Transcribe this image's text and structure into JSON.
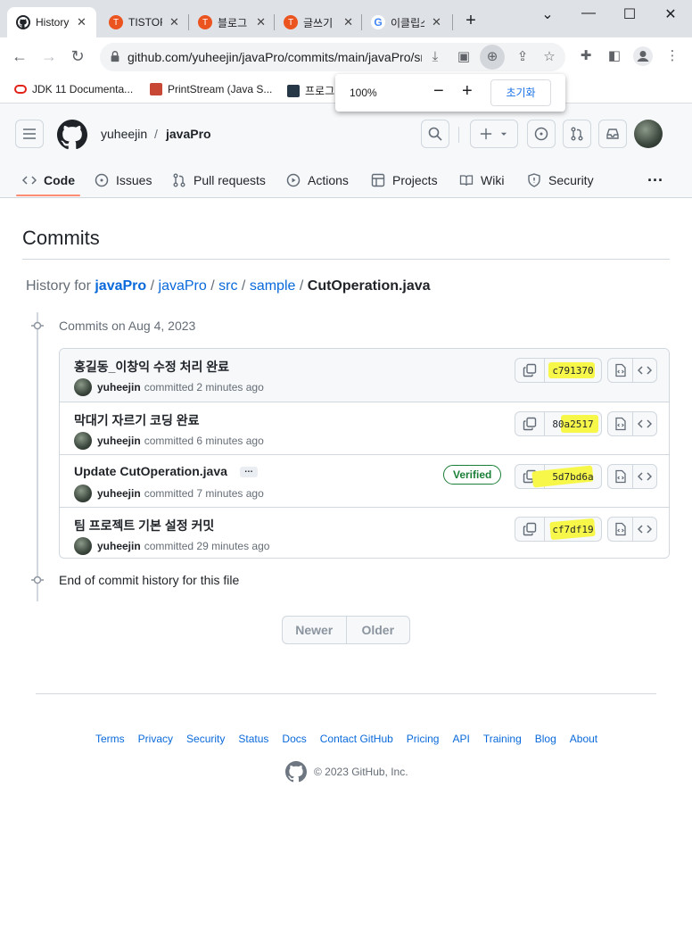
{
  "browser": {
    "tabs": [
      {
        "title": "History",
        "icon": "github-icon"
      },
      {
        "title": "TISTORY",
        "icon": "tistory-icon"
      },
      {
        "title": "블로그",
        "icon": "tistory-icon"
      },
      {
        "title": "글쓰기",
        "icon": "tistory-icon"
      },
      {
        "title": "이클립스",
        "icon": "google-icon"
      }
    ],
    "url": "github.com/yuheejin/javaPro/commits/main/javaPro/src/sample/CutOperation.java",
    "bookmarks": [
      {
        "label": "JDK 11 Documenta...",
        "icon": "oracle-icon"
      },
      {
        "label": "PrintStream (Java S...",
        "icon": "oracle-icon"
      },
      {
        "label": "프로그",
        "icon": "programmers-icon"
      }
    ],
    "zoom_popup": {
      "level": "100%",
      "minus": "−",
      "plus": "+",
      "reset_label": "초기화"
    }
  },
  "header": {
    "owner": "yuheejin",
    "separator": "/",
    "repo": "javaPro"
  },
  "repo_nav": [
    {
      "label": "Code",
      "active": true
    },
    {
      "label": "Issues"
    },
    {
      "label": "Pull requests"
    },
    {
      "label": "Actions"
    },
    {
      "label": "Projects"
    },
    {
      "label": "Wiki"
    },
    {
      "label": "Security"
    }
  ],
  "page": {
    "title": "Commits",
    "history": {
      "prefix": "History for",
      "repo_link": "javaPro",
      "segments": [
        "javaPro",
        "src",
        "sample"
      ],
      "file": "CutOperation.java",
      "sep": "/"
    },
    "group_heading": "Commits on Aug 4, 2023",
    "commits": [
      {
        "message": "홍길동_이창익 수정 처리 완료",
        "author": "yuheejin",
        "verb": "committed",
        "time": "2 minutes ago",
        "sha": "c791370"
      },
      {
        "message": "막대기 자르기 코딩 완료",
        "author": "yuheejin",
        "verb": "committed",
        "time": "6 minutes ago",
        "sha": "80a2517"
      },
      {
        "message": "Update CutOperation.java",
        "author": "yuheejin",
        "verb": "committed",
        "time": "7 minutes ago",
        "sha": "5d7bd6a",
        "verified": "Verified",
        "ellipsis": "…"
      },
      {
        "message": "팀 프로젝트 기본 설정 커밋",
        "author": "yuheejin",
        "verb": "committed",
        "time": "29 minutes ago",
        "sha": "cf7df19"
      }
    ],
    "end_text": "End of commit history for this file",
    "pager": {
      "newer": "Newer",
      "older": "Older"
    }
  },
  "footer": {
    "links": [
      "Terms",
      "Privacy",
      "Security",
      "Status",
      "Docs",
      "Contact GitHub",
      "Pricing",
      "API",
      "Training",
      "Blog",
      "About"
    ],
    "copyright": "© 2023 GitHub, Inc."
  },
  "colors": {
    "accent_link": "#0969da",
    "nav_underline": "#fd8c73",
    "verified": "#1a7f37",
    "highlight": "#f7f74a"
  }
}
